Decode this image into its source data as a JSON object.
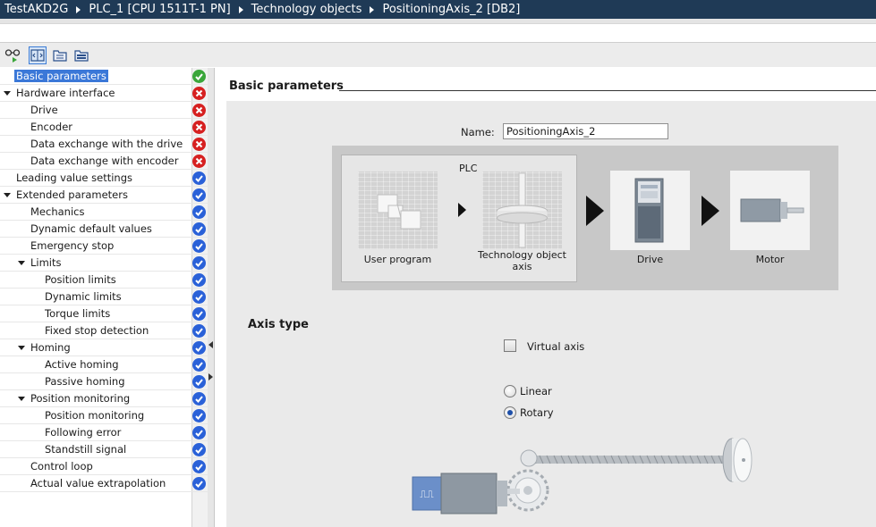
{
  "breadcrumb": [
    {
      "label": "TestAKD2G"
    },
    {
      "label": "PLC_1 [CPU 1511T-1 PN]"
    },
    {
      "label": "Technology objects"
    },
    {
      "label": "PositioningAxis_2 [DB2]"
    }
  ],
  "toolbar": {
    "buttons": [
      {
        "icon": "glasses-icon"
      },
      {
        "icon": "expand-columns-icon",
        "active": true
      },
      {
        "icon": "folder-tree-icon"
      },
      {
        "icon": "folder-list-icon"
      }
    ]
  },
  "nav": {
    "items": [
      {
        "label": "Basic parameters",
        "status": "ok",
        "selected": true
      },
      {
        "label": "Hardware interface",
        "status": "error",
        "expanded": true
      },
      {
        "label": "Drive",
        "status": "error"
      },
      {
        "label": "Encoder",
        "status": "error"
      },
      {
        "label": "Data exchange with the drive",
        "status": "error"
      },
      {
        "label": "Data exchange with encoder",
        "status": "error"
      },
      {
        "label": "Leading value settings",
        "status": "ok-blue"
      },
      {
        "label": "Extended parameters",
        "status": "ok-blue",
        "expanded": true
      },
      {
        "label": "Mechanics",
        "status": "ok-blue"
      },
      {
        "label": "Dynamic default values",
        "status": "ok-blue"
      },
      {
        "label": "Emergency stop",
        "status": "ok-blue"
      },
      {
        "label": "Limits",
        "status": "ok-blue",
        "expanded": true
      },
      {
        "label": "Position limits",
        "status": "ok-blue"
      },
      {
        "label": "Dynamic limits",
        "status": "ok-blue"
      },
      {
        "label": "Torque limits",
        "status": "ok-blue"
      },
      {
        "label": "Fixed stop detection",
        "status": "ok-blue"
      },
      {
        "label": "Homing",
        "status": "ok-blue",
        "expanded": true
      },
      {
        "label": "Active homing",
        "status": "ok-blue"
      },
      {
        "label": "Passive homing",
        "status": "ok-blue"
      },
      {
        "label": "Position monitoring",
        "status": "ok-blue",
        "expanded": true
      },
      {
        "label": "Position monitoring",
        "status": "ok-blue"
      },
      {
        "label": "Following error",
        "status": "ok-blue"
      },
      {
        "label": "Standstill signal",
        "status": "ok-blue"
      },
      {
        "label": "Control loop",
        "status": "ok-blue"
      },
      {
        "label": "Actual value extrapolation",
        "status": "ok-blue"
      }
    ]
  },
  "main": {
    "section_title": "Basic parameters",
    "name_label": "Name:",
    "name_value": "PositioningAxis_2",
    "diagram": {
      "plc_label": "PLC",
      "user_program": "User program",
      "technology_object": "Technology object axis",
      "drive": "Drive",
      "motor": "Motor"
    },
    "axis_type": {
      "title": "Axis type",
      "virtual_axis_label": "Virtual axis",
      "virtual_axis_checked": false,
      "options": [
        {
          "label": "Linear",
          "selected": false
        },
        {
          "label": "Rotary",
          "selected": true
        }
      ]
    }
  },
  "colors": {
    "title_bar": "#1f3a56",
    "selection": "#3b78d8",
    "status_ok": "#3aa63a",
    "status_error": "#d62020",
    "status_blue": "#2a61d8"
  }
}
